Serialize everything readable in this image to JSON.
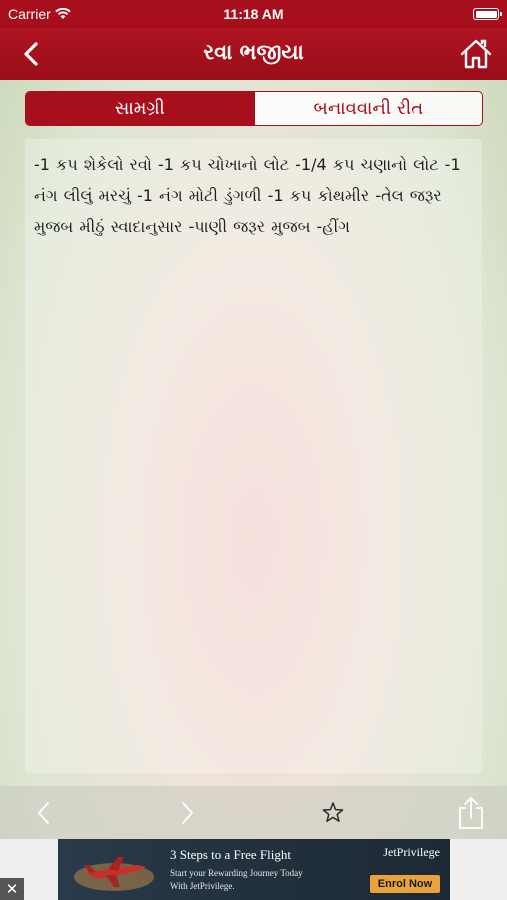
{
  "status_bar": {
    "carrier": "Carrier",
    "time": "11:18 AM"
  },
  "nav": {
    "title": "રવા ભજીયા"
  },
  "tabs": [
    {
      "label": "સામગ્રી",
      "selected": true
    },
    {
      "label": "બનાવવાની રીત",
      "selected": false
    }
  ],
  "content": {
    "ingredients_text": "-1 કપ શેકેલો રવો -1 કપ ચોખાનો લોટ -1/4 કપ ચણાનો લોટ -1 નંગ લીલું મરચું -1 નંગ મોટી ડુંગળી -1 કપ કોથમીર -તેલ જરૂર મુજબ મીઠું સ્વાદાનુસાર -પાણી જરૂર મુજબ -હીંગ"
  },
  "ad": {
    "headline": "3 Steps to a Free Flight",
    "line1": "Start your Rewarding Journey Today",
    "line2": "With JetPrivilege.",
    "brand": "JetPrivilege",
    "cta": "Enrol Now",
    "close": "✕"
  },
  "colors": {
    "brand_red": "#a70f1c",
    "toolbar_icon": "#ffffff"
  }
}
